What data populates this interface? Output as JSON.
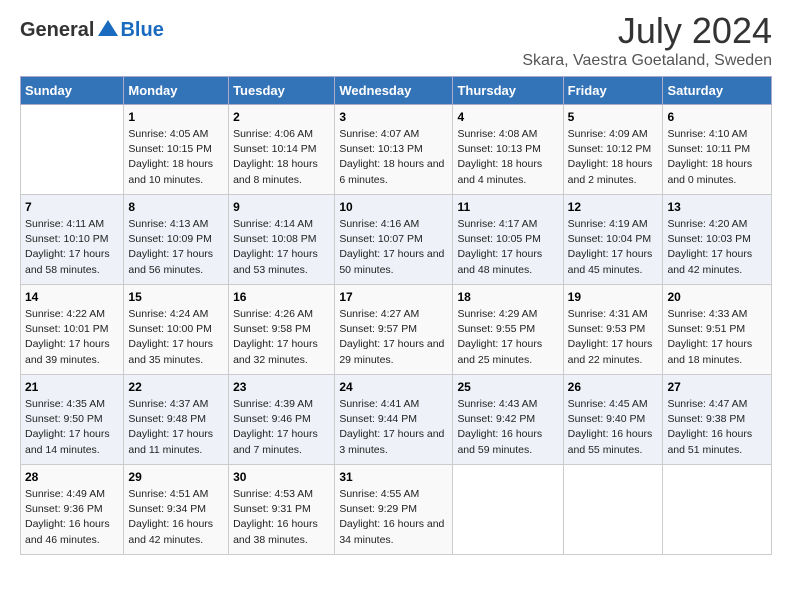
{
  "header": {
    "logo_general": "General",
    "logo_blue": "Blue",
    "title": "July 2024",
    "subtitle": "Skara, Vaestra Goetaland, Sweden"
  },
  "days_of_week": [
    "Sunday",
    "Monday",
    "Tuesday",
    "Wednesday",
    "Thursday",
    "Friday",
    "Saturday"
  ],
  "weeks": [
    [
      {
        "day": "",
        "sunrise": "",
        "sunset": "",
        "daylight": ""
      },
      {
        "day": "1",
        "sunrise": "Sunrise: 4:05 AM",
        "sunset": "Sunset: 10:15 PM",
        "daylight": "Daylight: 18 hours and 10 minutes."
      },
      {
        "day": "2",
        "sunrise": "Sunrise: 4:06 AM",
        "sunset": "Sunset: 10:14 PM",
        "daylight": "Daylight: 18 hours and 8 minutes."
      },
      {
        "day": "3",
        "sunrise": "Sunrise: 4:07 AM",
        "sunset": "Sunset: 10:13 PM",
        "daylight": "Daylight: 18 hours and 6 minutes."
      },
      {
        "day": "4",
        "sunrise": "Sunrise: 4:08 AM",
        "sunset": "Sunset: 10:13 PM",
        "daylight": "Daylight: 18 hours and 4 minutes."
      },
      {
        "day": "5",
        "sunrise": "Sunrise: 4:09 AM",
        "sunset": "Sunset: 10:12 PM",
        "daylight": "Daylight: 18 hours and 2 minutes."
      },
      {
        "day": "6",
        "sunrise": "Sunrise: 4:10 AM",
        "sunset": "Sunset: 10:11 PM",
        "daylight": "Daylight: 18 hours and 0 minutes."
      }
    ],
    [
      {
        "day": "7",
        "sunrise": "Sunrise: 4:11 AM",
        "sunset": "Sunset: 10:10 PM",
        "daylight": "Daylight: 17 hours and 58 minutes."
      },
      {
        "day": "8",
        "sunrise": "Sunrise: 4:13 AM",
        "sunset": "Sunset: 10:09 PM",
        "daylight": "Daylight: 17 hours and 56 minutes."
      },
      {
        "day": "9",
        "sunrise": "Sunrise: 4:14 AM",
        "sunset": "Sunset: 10:08 PM",
        "daylight": "Daylight: 17 hours and 53 minutes."
      },
      {
        "day": "10",
        "sunrise": "Sunrise: 4:16 AM",
        "sunset": "Sunset: 10:07 PM",
        "daylight": "Daylight: 17 hours and 50 minutes."
      },
      {
        "day": "11",
        "sunrise": "Sunrise: 4:17 AM",
        "sunset": "Sunset: 10:05 PM",
        "daylight": "Daylight: 17 hours and 48 minutes."
      },
      {
        "day": "12",
        "sunrise": "Sunrise: 4:19 AM",
        "sunset": "Sunset: 10:04 PM",
        "daylight": "Daylight: 17 hours and 45 minutes."
      },
      {
        "day": "13",
        "sunrise": "Sunrise: 4:20 AM",
        "sunset": "Sunset: 10:03 PM",
        "daylight": "Daylight: 17 hours and 42 minutes."
      }
    ],
    [
      {
        "day": "14",
        "sunrise": "Sunrise: 4:22 AM",
        "sunset": "Sunset: 10:01 PM",
        "daylight": "Daylight: 17 hours and 39 minutes."
      },
      {
        "day": "15",
        "sunrise": "Sunrise: 4:24 AM",
        "sunset": "Sunset: 10:00 PM",
        "daylight": "Daylight: 17 hours and 35 minutes."
      },
      {
        "day": "16",
        "sunrise": "Sunrise: 4:26 AM",
        "sunset": "Sunset: 9:58 PM",
        "daylight": "Daylight: 17 hours and 32 minutes."
      },
      {
        "day": "17",
        "sunrise": "Sunrise: 4:27 AM",
        "sunset": "Sunset: 9:57 PM",
        "daylight": "Daylight: 17 hours and 29 minutes."
      },
      {
        "day": "18",
        "sunrise": "Sunrise: 4:29 AM",
        "sunset": "Sunset: 9:55 PM",
        "daylight": "Daylight: 17 hours and 25 minutes."
      },
      {
        "day": "19",
        "sunrise": "Sunrise: 4:31 AM",
        "sunset": "Sunset: 9:53 PM",
        "daylight": "Daylight: 17 hours and 22 minutes."
      },
      {
        "day": "20",
        "sunrise": "Sunrise: 4:33 AM",
        "sunset": "Sunset: 9:51 PM",
        "daylight": "Daylight: 17 hours and 18 minutes."
      }
    ],
    [
      {
        "day": "21",
        "sunrise": "Sunrise: 4:35 AM",
        "sunset": "Sunset: 9:50 PM",
        "daylight": "Daylight: 17 hours and 14 minutes."
      },
      {
        "day": "22",
        "sunrise": "Sunrise: 4:37 AM",
        "sunset": "Sunset: 9:48 PM",
        "daylight": "Daylight: 17 hours and 11 minutes."
      },
      {
        "day": "23",
        "sunrise": "Sunrise: 4:39 AM",
        "sunset": "Sunset: 9:46 PM",
        "daylight": "Daylight: 17 hours and 7 minutes."
      },
      {
        "day": "24",
        "sunrise": "Sunrise: 4:41 AM",
        "sunset": "Sunset: 9:44 PM",
        "daylight": "Daylight: 17 hours and 3 minutes."
      },
      {
        "day": "25",
        "sunrise": "Sunrise: 4:43 AM",
        "sunset": "Sunset: 9:42 PM",
        "daylight": "Daylight: 16 hours and 59 minutes."
      },
      {
        "day": "26",
        "sunrise": "Sunrise: 4:45 AM",
        "sunset": "Sunset: 9:40 PM",
        "daylight": "Daylight: 16 hours and 55 minutes."
      },
      {
        "day": "27",
        "sunrise": "Sunrise: 4:47 AM",
        "sunset": "Sunset: 9:38 PM",
        "daylight": "Daylight: 16 hours and 51 minutes."
      }
    ],
    [
      {
        "day": "28",
        "sunrise": "Sunrise: 4:49 AM",
        "sunset": "Sunset: 9:36 PM",
        "daylight": "Daylight: 16 hours and 46 minutes."
      },
      {
        "day": "29",
        "sunrise": "Sunrise: 4:51 AM",
        "sunset": "Sunset: 9:34 PM",
        "daylight": "Daylight: 16 hours and 42 minutes."
      },
      {
        "day": "30",
        "sunrise": "Sunrise: 4:53 AM",
        "sunset": "Sunset: 9:31 PM",
        "daylight": "Daylight: 16 hours and 38 minutes."
      },
      {
        "day": "31",
        "sunrise": "Sunrise: 4:55 AM",
        "sunset": "Sunset: 9:29 PM",
        "daylight": "Daylight: 16 hours and 34 minutes."
      },
      {
        "day": "",
        "sunrise": "",
        "sunset": "",
        "daylight": ""
      },
      {
        "day": "",
        "sunrise": "",
        "sunset": "",
        "daylight": ""
      },
      {
        "day": "",
        "sunrise": "",
        "sunset": "",
        "daylight": ""
      }
    ]
  ]
}
